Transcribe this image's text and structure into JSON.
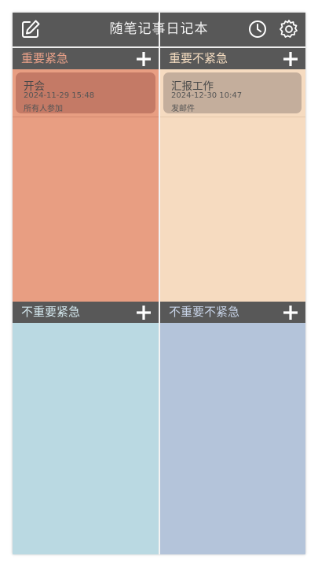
{
  "header": {
    "title": "随笔记事日记本",
    "left_icon": "edit-icon",
    "right_icons": [
      "clock-icon",
      "gear-icon"
    ]
  },
  "quadrants": [
    {
      "label": "重要紧急",
      "label_color": "#e8a088",
      "body_color": "#e89e82",
      "card_color": "#c47a66",
      "items": [
        {
          "title": "开会",
          "time": "2024-11-29 15:48",
          "note": "所有人参加"
        }
      ]
    },
    {
      "label": "重要不紧急",
      "label_color": "#f4dcc0",
      "body_color": "#f6dbc0",
      "card_color": "#c4ae9c",
      "items": [
        {
          "title": "汇报工作",
          "time": "2024-12-30 10:47",
          "note": "发邮件"
        }
      ]
    },
    {
      "label": "不重要紧急",
      "label_color": "#d4e8ee",
      "body_color": "#bad9e2",
      "items": []
    },
    {
      "label": "不重要不紧急",
      "label_color": "#c8d4e8",
      "body_color": "#b4c4da",
      "items": []
    }
  ],
  "add_icon": "plus-icon"
}
